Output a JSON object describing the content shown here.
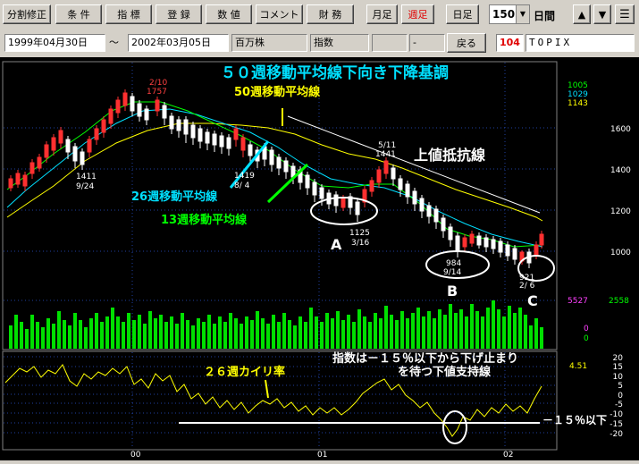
{
  "toolbar": {
    "buttons": [
      "分割修正",
      "条 件",
      "指 標",
      "登 録",
      "数 値",
      "コメント",
      "財 務",
      "月足",
      "週足",
      "日足"
    ],
    "period_value": "150",
    "period_unit": "日間",
    "up_icon": "▲",
    "down_icon": "▼",
    "menu_icon": "☰"
  },
  "info_bar": {
    "start_date": "1999年04月30日",
    "tilde": "～",
    "end_date": "2002年03月05日",
    "unit": "百万株",
    "index_label": "指数",
    "dash": "-",
    "back_button": "戻る",
    "code": "104",
    "name": "TOPIX"
  },
  "chart": {
    "title": "５０週移動平均線下向き下降基調",
    "ma_labels": {
      "ma50": "50週移動平均線",
      "ma26": "26週移動平均線",
      "ma13": "13週移動平均線"
    },
    "resistance_label": "上値抵抗線",
    "support_text_line1": "指数は－１５％以下から下げ止まり",
    "support_text_line2": "を待つ下値支持線",
    "kairi_label": "２６週カイリ率",
    "minus15_label": "－１５％以下",
    "points": [
      {
        "date": "2/10",
        "value": "1757"
      },
      {
        "date": "9/24",
        "value": "1411"
      },
      {
        "date": "8/ 4",
        "value": "1419"
      },
      {
        "date": "5/11",
        "value": "1441"
      },
      {
        "date": "3/16",
        "value": "1125"
      },
      {
        "date": "9/14",
        "value": "984"
      },
      {
        "date": "2/ 6",
        "value": "921"
      }
    ],
    "markers": [
      "A",
      "B",
      "C"
    ],
    "legend_ma": [
      "1005",
      "1029",
      "1143"
    ],
    "price_ticks": [
      "1600",
      "1400",
      "1200",
      "1000"
    ],
    "volume_values": {
      "latest": "5527",
      "max": "2558",
      "zero_a": "0",
      "zero_b": "0"
    },
    "kairi_value": "4.51",
    "kairi_ticks": [
      "20",
      "15",
      "10",
      "5",
      "0",
      "-5",
      "-10",
      "-15",
      "-20"
    ],
    "x_ticks": [
      "00",
      "01",
      "02"
    ],
    "colors": {
      "ma13": "#00ff00",
      "ma26": "#00e0ff",
      "ma50": "#ffff00",
      "up": "#ff3030",
      "down": "#ffffff",
      "volume": "#00ff00"
    }
  }
}
